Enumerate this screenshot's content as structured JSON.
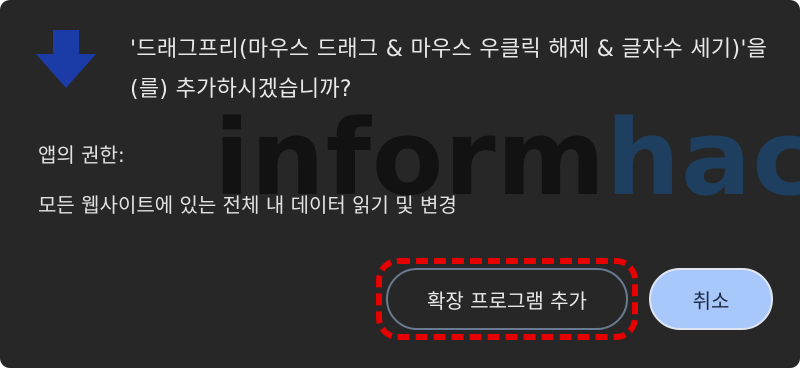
{
  "dialog": {
    "title": "'드래그프리(마우스 드래그 & 마우스 우클릭 해제 & 글자수 세기)'을(를) 추가하시겠습니까?",
    "permissions_heading": "앱의 권한:",
    "permissions": [
      "모든 웹사이트에 있는 전체 내 데이터 읽기 및 변경"
    ],
    "add_button_label": "확장 프로그램 추가",
    "cancel_button_label": "취소"
  },
  "watermark": {
    "part1": "inform",
    "part2": "hack"
  },
  "icons": {
    "extension": "download-arrow-icon"
  },
  "colors": {
    "dialog_bg": "#272727",
    "arrow_icon": "#1b3ba6",
    "cancel_bg": "#a8c7fa",
    "highlight": "#e60000",
    "watermark_dark": "#121212",
    "watermark_blue": "#1f3f60"
  }
}
